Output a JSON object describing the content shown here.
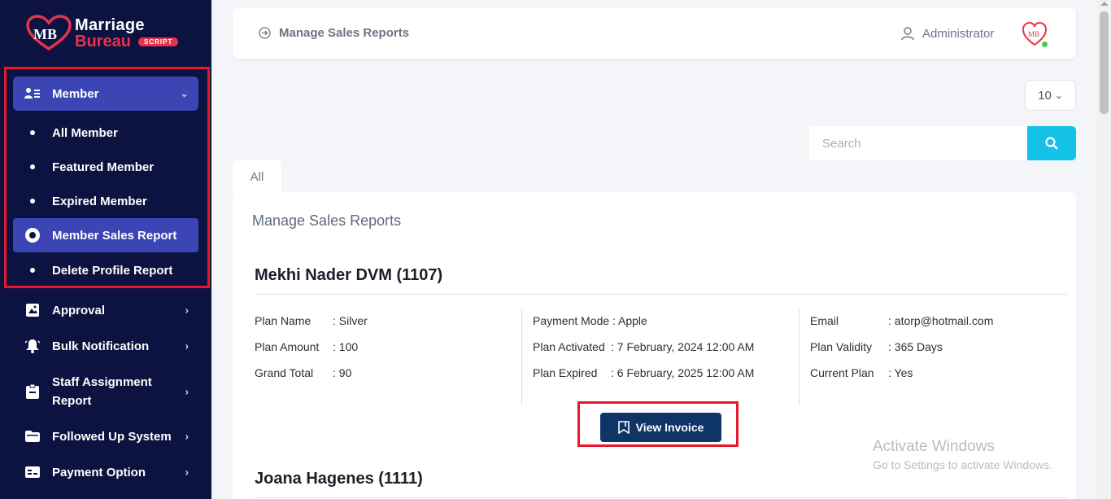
{
  "brand": {
    "line1": "Marriage",
    "line2": "Bureau",
    "badge": "SCRIPT",
    "monogram": "MB"
  },
  "sidebar": {
    "member": {
      "label": "Member",
      "icon": "user-list-icon"
    },
    "sub_items": [
      {
        "label": "All Member"
      },
      {
        "label": "Featured Member"
      },
      {
        "label": "Expired Member"
      },
      {
        "label": "Member Sales Report",
        "active": true
      },
      {
        "label": "Delete Profile Report"
      }
    ],
    "items": [
      {
        "label": "Approval",
        "icon": "approval-icon"
      },
      {
        "label": "Bulk Notification",
        "icon": "bell-icon"
      },
      {
        "label": "Staff Assignment Report",
        "icon": "clipboard-icon"
      },
      {
        "label": "Followed Up System",
        "icon": "folder-icon"
      },
      {
        "label": "Payment Option",
        "icon": "payment-card-icon"
      }
    ]
  },
  "header": {
    "breadcrumb": "Manage Sales Reports",
    "user": "Administrator"
  },
  "controls": {
    "per_page": "10",
    "search_placeholder": "Search",
    "tab_all": "All"
  },
  "card": {
    "title": "Manage Sales Reports",
    "records": [
      {
        "name": "Mekhi Nader DVM (1107)",
        "plan_name_label": "Plan Name",
        "plan_name": ": Silver",
        "plan_amount_label": "Plan Amount",
        "plan_amount": ": 100",
        "grand_total_label": "Grand Total",
        "grand_total": ": 90",
        "payment_mode_label": "Payment Mode",
        "payment_mode": ": Apple",
        "plan_activated_label": "Plan Activated",
        "plan_activated": ": 7 February, 2024 12:00 AM",
        "plan_expired_label": "Plan Expired",
        "plan_expired": ": 6 February, 2025 12:00 AM",
        "email_label": "Email",
        "email": ": atorp@hotmail.com",
        "plan_validity_label": "Plan Validity",
        "plan_validity": ": 365 Days",
        "current_plan_label": "Current Plan",
        "current_plan": ": Yes",
        "invoice_label": "View Invoice"
      },
      {
        "name": "Joana Hagenes (1111)"
      }
    ]
  },
  "watermark": {
    "line1": "Activate Windows",
    "line2": "Go to Settings to activate Windows."
  },
  "colors": {
    "sidebar_bg": "#0d1340",
    "active_bg": "#3b46b4",
    "highlight": "#e8172a",
    "search_btn": "#13c2e6",
    "invoice_btn": "#0e3566"
  }
}
